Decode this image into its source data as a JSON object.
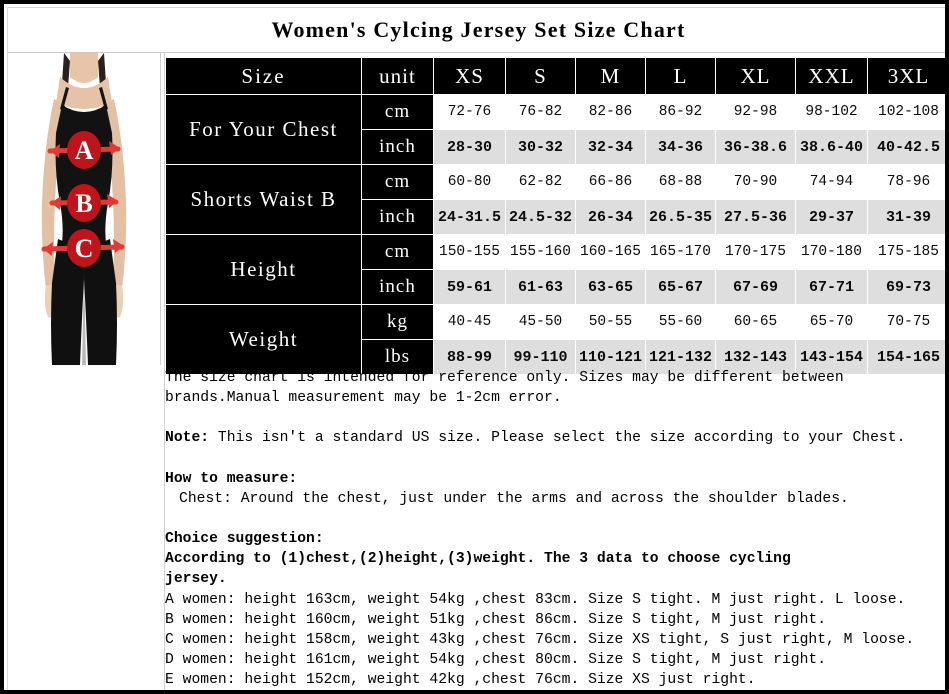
{
  "title": "Women's Cylcing Jersey Set Size Chart",
  "photo": {
    "alt_name": "model-size-measurement-photo",
    "markers": [
      "A",
      "B",
      "C"
    ],
    "marker_colors": {
      "circle": "#c0141c",
      "arrow": "#e03a34"
    },
    "body_color": "#141414",
    "skin_color": "#e4bfa5",
    "background": "#ffffff"
  },
  "table": {
    "corner_label": "Size",
    "unit_header": "unit",
    "sizes": [
      "XS",
      "S",
      "M",
      "L",
      "XL",
      "XXL",
      "3XL"
    ],
    "groups": [
      {
        "label": "For Your Chest",
        "rows": [
          {
            "unit": "cm",
            "values": [
              "72-76",
              "76-82",
              "82-86",
              "86-92",
              "92-98",
              "98-102",
              "102-108"
            ]
          },
          {
            "unit": "inch",
            "values": [
              "28-30",
              "30-32",
              "32-34",
              "34-36",
              "36-38.6",
              "38.6-40",
              "40-42.5"
            ]
          }
        ]
      },
      {
        "label": "Shorts Waist B",
        "rows": [
          {
            "unit": "cm",
            "values": [
              "60-80",
              "62-82",
              "66-86",
              "68-88",
              "70-90",
              "74-94",
              "78-96"
            ]
          },
          {
            "unit": "inch",
            "values": [
              "24-31.5",
              "24.5-32",
              "26-34",
              "26.5-35",
              "27.5-36",
              "29-37",
              "31-39"
            ]
          }
        ]
      },
      {
        "label": "Height",
        "rows": [
          {
            "unit": "cm",
            "values": [
              "150-155",
              "155-160",
              "160-165",
              "165-170",
              "170-175",
              "170-180",
              "175-185"
            ]
          },
          {
            "unit": "inch",
            "values": [
              "59-61",
              "61-63",
              "63-65",
              "65-67",
              "67-69",
              "67-71",
              "69-73"
            ]
          }
        ]
      },
      {
        "label": "Weight",
        "rows": [
          {
            "unit": "kg",
            "values": [
              "40-45",
              "45-50",
              "50-55",
              "55-60",
              "60-65",
              "65-70",
              "70-75"
            ]
          },
          {
            "unit": "lbs",
            "values": [
              "88-99",
              "99-110",
              "110-121",
              "121-132",
              "132-143",
              "143-154",
              "154-165"
            ]
          }
        ]
      }
    ]
  },
  "notes": {
    "disclaimer_line1": "The size chart is intended for reference only. Sizes may be different between",
    "disclaimer_line2": "brands.Manual measurement may be 1-2cm error.",
    "note_label": "Note:",
    "note_text": " This isn't a standard US size. Please select the size according to your Chest.",
    "how_to_measure_label": "How to measure:",
    "how_to_measure_text": "Chest: Around the chest, just under the arms and across the shoulder blades.",
    "choice_label": "Choice suggestion:",
    "choice_line1": "According to (1)chest,(2)height,(3)weight. The 3 data to choose cycling",
    "choice_line2": "jersey.",
    "examples": [
      "A women: height 163cm, weight 54kg ,chest 83cm. Size S tight. M just right. L loose.",
      "B women: height 160cm, weight 51kg ,chest 86cm. Size S tight, M just right.",
      "C women: height 158cm, weight 43kg ,chest 76cm. Size XS tight, S just right, M loose.",
      "D women: height 161cm, weight 54kg ,chest 80cm. Size S tight, M just right.",
      "E women: height 152cm, weight 42kg ,chest 76cm. Size XS just right."
    ]
  }
}
